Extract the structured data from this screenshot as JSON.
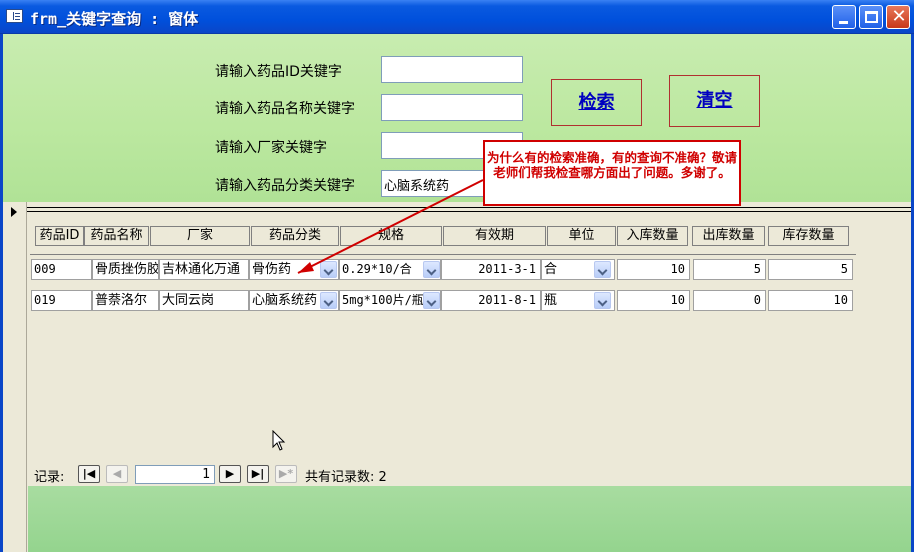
{
  "window": {
    "title": "frm_关键字查询 : 窗体"
  },
  "search": {
    "label_id": "请输入药品ID关键字",
    "value_id": "",
    "label_name": "请输入药品名称关键字",
    "value_name": "",
    "label_maker": "请输入厂家关键字",
    "value_maker": "",
    "label_category": "请输入药品分类关键字",
    "value_category": "心脑系统药",
    "search_button": "检索",
    "clear_button": "清空"
  },
  "table": {
    "headers": [
      "药品ID",
      "药品名称",
      "厂家",
      "药品分类",
      "规格",
      "有效期",
      "单位",
      "入库数量",
      "出库数量",
      "库存数量"
    ],
    "rows": [
      {
        "id": "009",
        "name": "骨质挫伤胶",
        "maker": "吉林通化万通",
        "category": "骨伤药",
        "spec": "0.29*10/合",
        "expiry": "2011-3-1",
        "unit": "合",
        "in_qty": "10",
        "out_qty": "5",
        "stock": "5"
      },
      {
        "id": "019",
        "name": "普萘洛尔",
        "maker": "大同云岗",
        "category": "心脑系统药",
        "spec": "5mg*100片/瓶",
        "expiry": "2011-8-1",
        "unit": "瓶",
        "in_qty": "10",
        "out_qty": "0",
        "stock": "10"
      }
    ]
  },
  "navigation": {
    "label": "记录:",
    "current": "1",
    "total_text": "共有记录数: 2"
  },
  "annotation": {
    "text": "为什么有的检索准确，有的查询不准确？敬请老师们帮我检查哪方面出了问题。多谢了。"
  },
  "colors": {
    "title_bar": "#0050dc",
    "header_bg": "#c8ecb0",
    "footer_bg": "#a8dca0",
    "annotation_red": "#d00000",
    "link_blue": "#0000c0"
  }
}
